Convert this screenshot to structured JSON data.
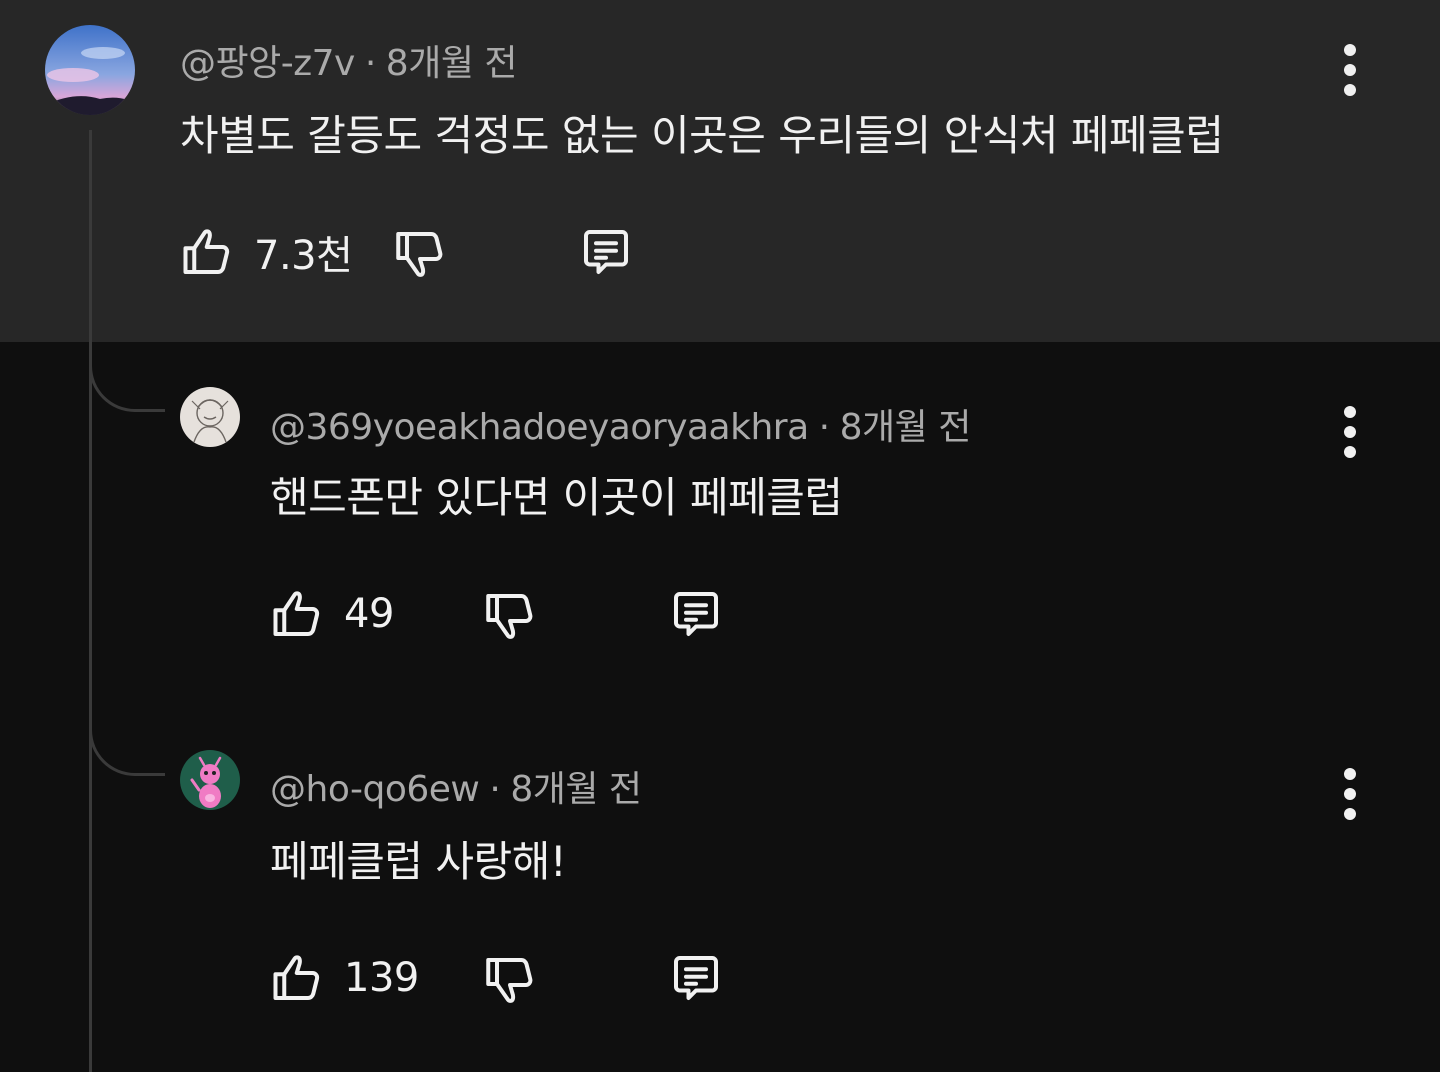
{
  "comments": [
    {
      "handle": "@팡앙-z7v",
      "separator": "·",
      "time": "8개월 전",
      "text": "차별도 갈등도 걱정도 없는 이곳은 우리들의 안식처 페페클럽",
      "likes": "7.3천",
      "avatar": "sky-landscape-avatar"
    },
    {
      "handle": "@369yoeakhadoeyaoryaakhra",
      "separator": "·",
      "time": "8개월 전",
      "text": "핸드폰만 있다면 이곳이 페페클럽",
      "likes": "49",
      "avatar": "sketch-drawing-avatar"
    },
    {
      "handle": "@ho-qo6ew",
      "separator": "·",
      "time": "8개월 전",
      "text": "페페클럽 사랑해!",
      "likes": "139",
      "avatar": "pink-alien-avatar"
    }
  ],
  "icons": {
    "like": "thumbs-up-icon",
    "dislike": "thumbs-down-icon",
    "reply": "reply-comment-icon",
    "more": "more-vert-icon"
  },
  "colors": {
    "highlight_background": "#272727",
    "page_background": "#0f0f0f",
    "text_primary": "#f1f1f1",
    "text_secondary": "#aaaaaa"
  }
}
